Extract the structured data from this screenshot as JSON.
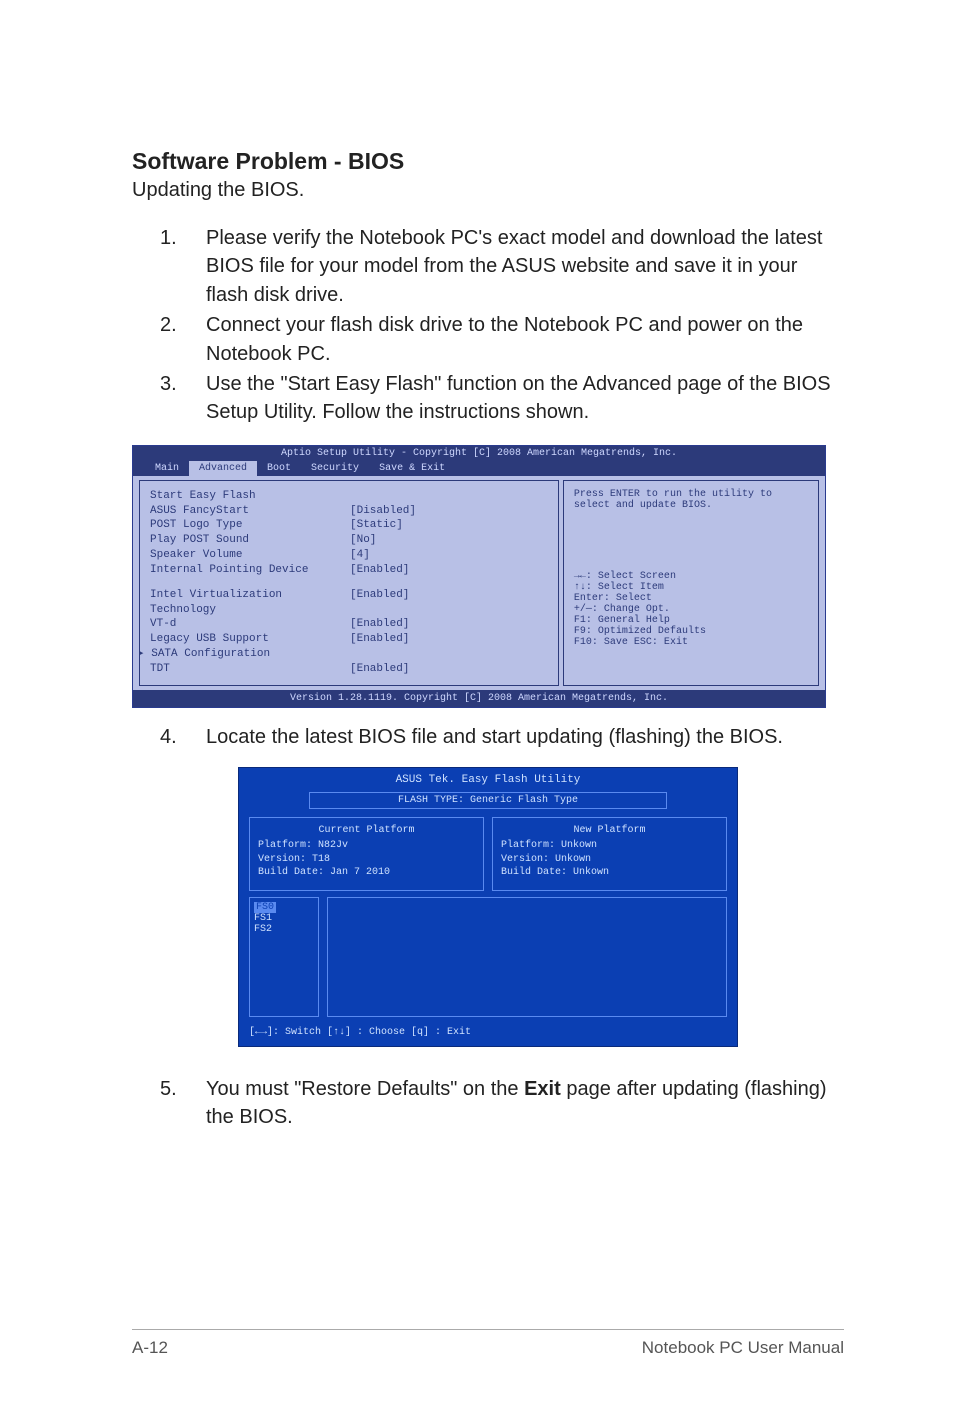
{
  "heading": "Software Problem - BIOS",
  "subheading": "Updating the BIOS.",
  "steps_top": [
    {
      "num": "1.",
      "text": "Please verify the Notebook PC's exact model and download the latest BIOS file for your model from the ASUS website and save it in your flash disk drive."
    },
    {
      "num": "2.",
      "text": "Connect your flash disk drive to the Notebook PC and power on the Notebook PC."
    },
    {
      "num": "3.",
      "text": "Use the \"Start Easy Flash\" function on the Advanced page of the BIOS Setup Utility. Follow the instructions shown."
    }
  ],
  "bios": {
    "header": "Aptio Setup Utility - Copyright [C] 2008 American Megatrends, Inc.",
    "tabs": [
      "Main",
      "Advanced",
      "Boot",
      "Security",
      "Save & Exit"
    ],
    "active_tab": "Advanced",
    "rows": [
      {
        "label": "Start Easy Flash",
        "value": ""
      },
      {
        "label": "ASUS FancyStart",
        "value": "[Disabled]"
      },
      {
        "label": "POST Logo Type",
        "value": "[Static]"
      },
      {
        "label": "Play POST Sound",
        "value": "[No]"
      },
      {
        "label": "Speaker Volume",
        "value": "[4]"
      },
      {
        "label": "Internal Pointing Device",
        "value": "[Enabled]"
      }
    ],
    "rows2": [
      {
        "label": "Intel Virtualization Technology",
        "value": "[Enabled]"
      },
      {
        "label": "VT-d",
        "value": "[Enabled]"
      },
      {
        "label": "Legacy USB Support",
        "value": "[Enabled]"
      },
      {
        "label": "SATA Configuration",
        "value": "",
        "sel": true
      },
      {
        "label": "TDT",
        "value": "[Enabled]"
      }
    ],
    "help_top": "Press ENTER to run the utility to select and update BIOS.",
    "help_keys": [
      "→←: Select Screen",
      "↑↓:    Select Item",
      "Enter: Select",
      "+/—:  Change Opt.",
      "F1:    General Help",
      "F9:    Optimized Defaults",
      "F10:  Save    ESC: Exit"
    ],
    "footer": "Version 1.28.1119. Copyright [C] 2008 American Megatrends, Inc."
  },
  "step4": {
    "num": "4.",
    "text": "Locate the latest BIOS file and start updating (flashing) the BIOS."
  },
  "flash": {
    "title": "ASUS Tek. Easy Flash Utility",
    "type": "FLASH TYPE: Generic Flash Type",
    "current": {
      "title": "Current Platform",
      "platform": "Platform:   N82Jv",
      "version": "Version:    T18",
      "build": "Build Date: Jan 7 2010"
    },
    "new": {
      "title": "New Platform",
      "platform": "Platform:   Unkown",
      "version": "Version:    Unkown",
      "build": "Build Date: Unkown"
    },
    "fs": [
      "FS0",
      "FS1",
      "FS2"
    ],
    "keys": "[←→]: Switch   [↑↓] : Choose   [q] : Exit"
  },
  "step5": {
    "num": "5.",
    "text_before": "You must \"Restore Defaults\" on the ",
    "bold": "Exit",
    "text_after": " page after updating (flashing) the BIOS."
  },
  "footer": {
    "left": "A-12",
    "right": "Notebook PC User Manual"
  }
}
